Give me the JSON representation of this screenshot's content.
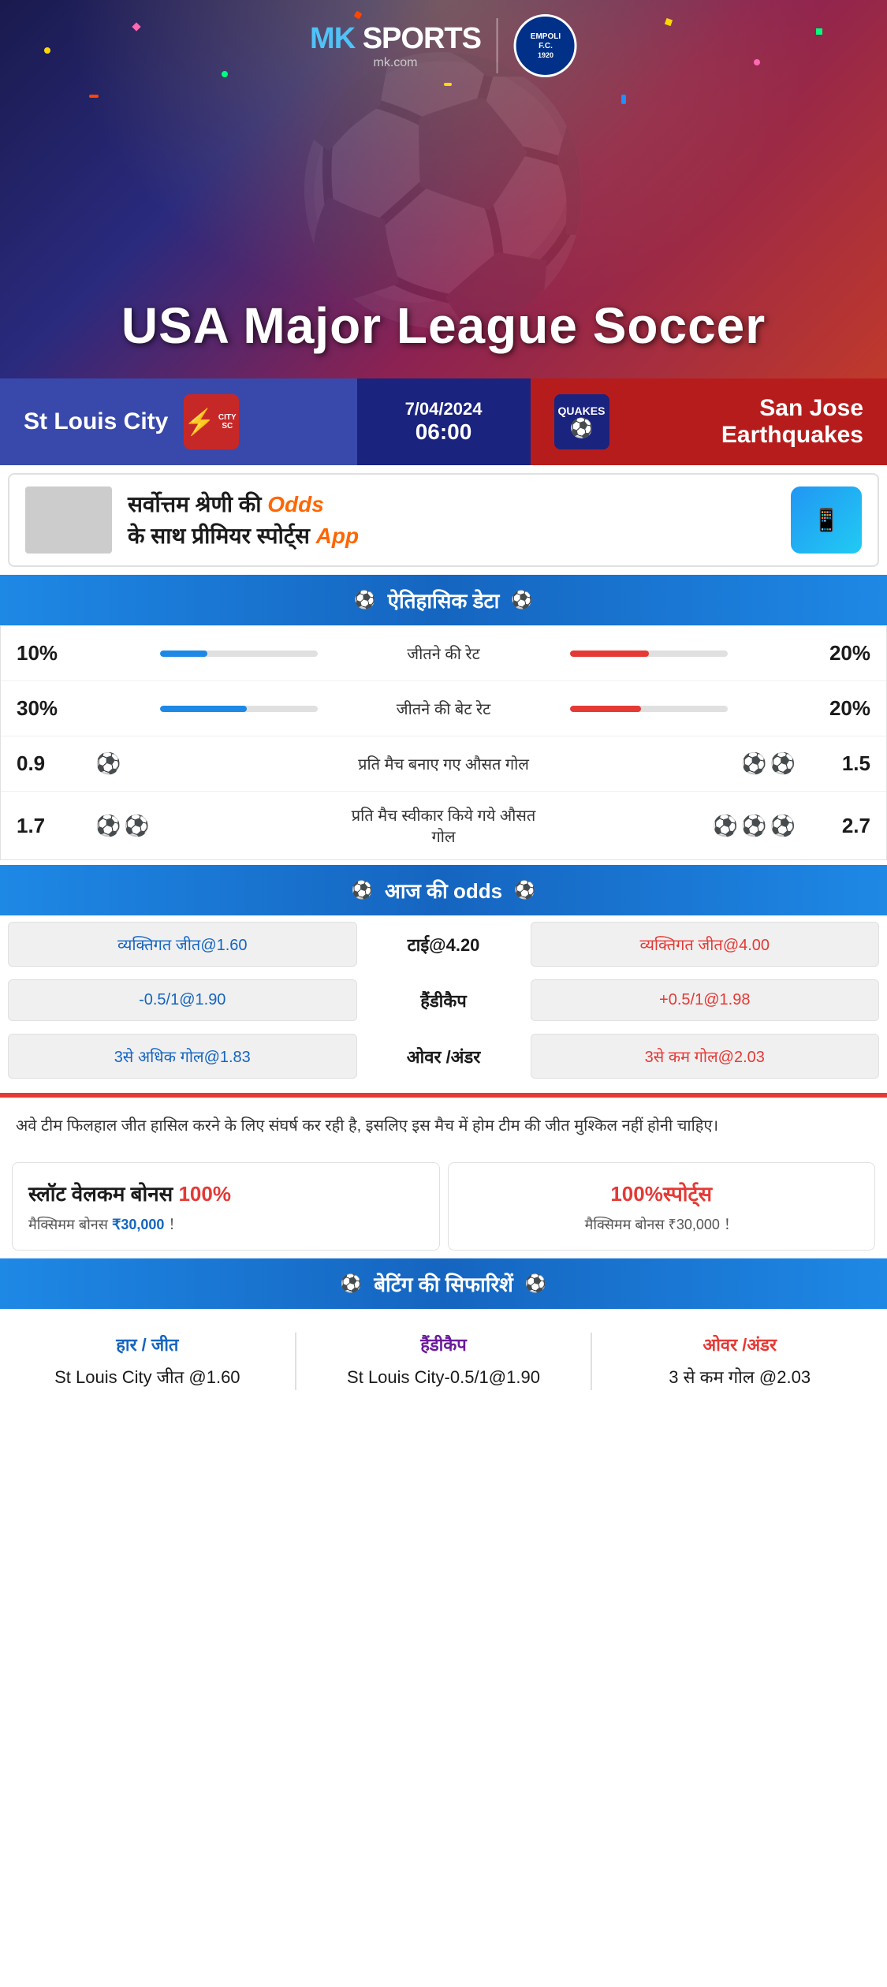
{
  "brand": {
    "name": "MK SPORTS",
    "sub": "mk.com",
    "divider": "|",
    "partner": {
      "name": "EMPOLI F.C.",
      "year": "1920"
    }
  },
  "hero": {
    "title": "USA Major League Soccer"
  },
  "match": {
    "date": "7/04/2024",
    "time": "06:00",
    "home": {
      "name": "St Louis City",
      "badge_text": "CITY SC",
      "badge_color": "#c62828"
    },
    "away": {
      "name": "San Jose Earthquakes",
      "badge_text": "QUAKES",
      "badge_color": "#1a237e"
    }
  },
  "promo": {
    "text": "सर्वोत्तम श्रेणी की Odds के साथ प्रीमियर स्पोर्ट्स App"
  },
  "historical": {
    "header": "ऐतिहासिक डेटा",
    "rows": [
      {
        "left_val": "10%",
        "label": "जीतने की रेट",
        "right_val": "20%",
        "left_pct": 30,
        "right_pct": 50
      },
      {
        "left_val": "30%",
        "label": "जीतने की बेट रेट",
        "right_val": "20%",
        "left_pct": 55,
        "right_pct": 45
      },
      {
        "left_val": "0.9",
        "label": "प्रति मैच बनाए गए औसत गोल",
        "right_val": "1.5",
        "left_balls": 1,
        "right_balls": 2
      },
      {
        "left_val": "1.7",
        "label": "प्रति मैच स्वीकार किये गये औसत गोल",
        "right_val": "2.7",
        "left_balls": 2,
        "right_balls": 3
      }
    ]
  },
  "odds": {
    "header": "आज की odds",
    "rows": [
      {
        "left_btn": "व्यक्तिगत जीत@1.60",
        "center": "टाई@4.20",
        "right_btn": "व्यक्तिगत जीत@4.00"
      },
      {
        "left_btn": "-0.5/1@1.90",
        "center": "हैंडीकैप",
        "right_btn": "+0.5/1@1.98"
      },
      {
        "left_btn": "3से अधिक गोल@1.83",
        "center": "ओवर /अंडर",
        "right_btn": "3से कम गोल@2.03"
      }
    ]
  },
  "analysis": {
    "text": "अवे टीम फिलहाल जीत हासिल करने के लिए संघर्ष कर रही है, इसलिए इस मैच में होम टीम की जीत मुश्किल नहीं होनी चाहिए।"
  },
  "bonus": {
    "left": {
      "title": "स्लॉट वेलकम बोनस 100%",
      "subtitle": "मैक्सिमम बोनस ₹30,000  ！"
    },
    "right": {
      "title": "100%स्पोर्ट्स",
      "subtitle": "मैक्सिमम बोनस  ₹30,000 ！"
    }
  },
  "betting_rec": {
    "header": "बेटिंग की सिफारिशें",
    "cols": [
      {
        "type": "हार / जीत",
        "type_color": "blue",
        "value": "St Louis City जीत @1.60"
      },
      {
        "type": "हैंडीकैप",
        "type_color": "purple",
        "value": "St Louis City-0.5/1@1.90"
      },
      {
        "type": "ओवर /अंडर",
        "type_color": "red",
        "value": "3 से कम गोल @2.03"
      }
    ]
  }
}
